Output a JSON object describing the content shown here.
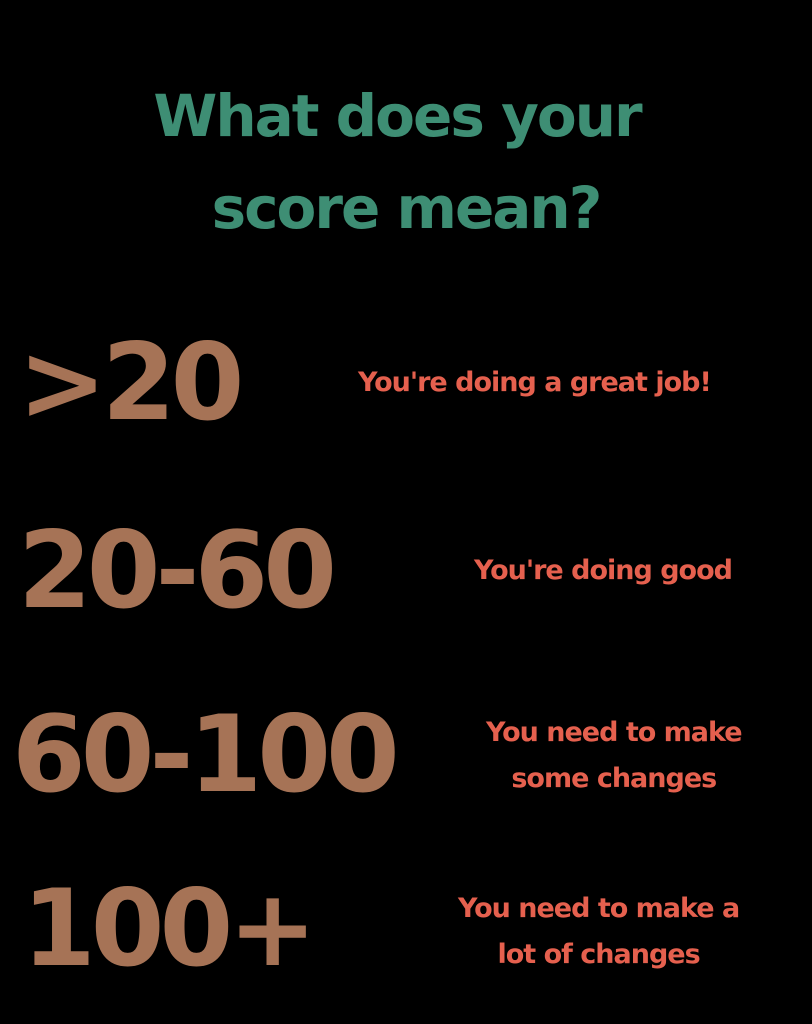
{
  "colors": {
    "background": "#000000",
    "title": "#3e8e74",
    "score": "#a67356",
    "message": "#e5604e"
  },
  "title": {
    "line1": "What does your",
    "line2": "score mean?"
  },
  "rows": [
    {
      "score": ">20",
      "message_lines": [
        "You're doing a great job!"
      ]
    },
    {
      "score": "20-60",
      "message_lines": [
        "You're doing good"
      ]
    },
    {
      "score": "60-100",
      "message_lines": [
        "You need to make",
        "some changes"
      ]
    },
    {
      "score": "100+",
      "message_lines": [
        "You need to make a",
        "lot of changes"
      ]
    }
  ]
}
